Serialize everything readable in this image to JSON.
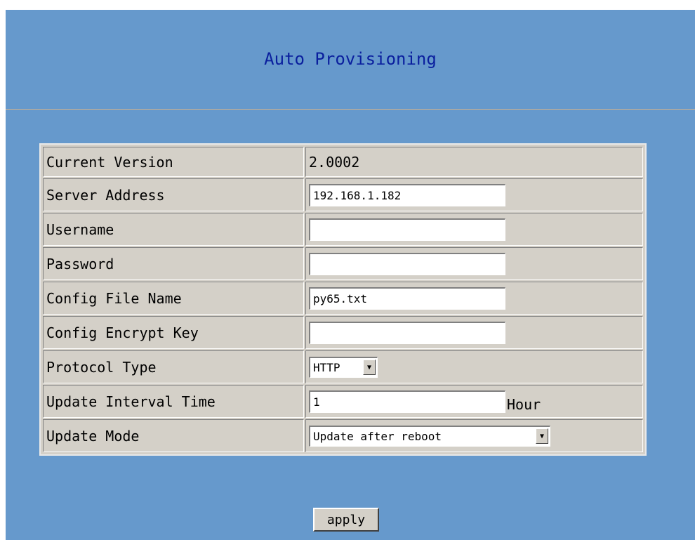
{
  "page": {
    "title": "Auto Provisioning"
  },
  "form": {
    "current_version": {
      "label": "Current Version",
      "value": "2.0002"
    },
    "server_address": {
      "label": "Server Address",
      "value": "192.168.1.182"
    },
    "username": {
      "label": "Username",
      "value": ""
    },
    "password": {
      "label": "Password",
      "value": ""
    },
    "config_file_name": {
      "label": "Config File Name",
      "value": "py65.txt"
    },
    "config_encrypt_key": {
      "label": "Config Encrypt Key",
      "value": ""
    },
    "protocol_type": {
      "label": "Protocol Type",
      "selected": "HTTP"
    },
    "update_interval_time": {
      "label": "Update Interval Time",
      "value": "1",
      "unit": "Hour"
    },
    "update_mode": {
      "label": "Update Mode",
      "selected": "Update after reboot"
    }
  },
  "buttons": {
    "apply": "apply"
  },
  "icons": {
    "dropdown": "chevron-down-icon"
  },
  "colors": {
    "background": "#6699cc",
    "title": "#0a1f9e",
    "table": "#d4d0c8"
  }
}
